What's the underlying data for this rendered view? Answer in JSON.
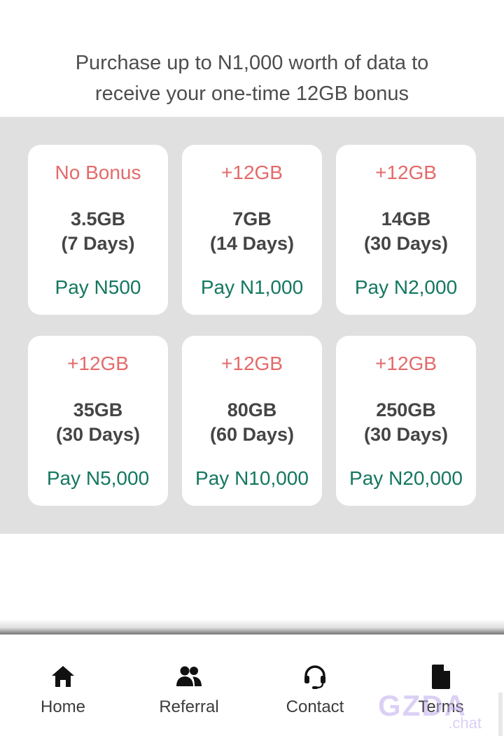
{
  "header": {
    "line1": "Purchase up to N1,000 worth of data to",
    "line2": "receive your one-time 12GB bonus"
  },
  "plans": [
    {
      "bonus": "No Bonus",
      "size": "3.5GB",
      "duration": "(7 Days)",
      "price": "Pay N500"
    },
    {
      "bonus": "+12GB",
      "size": "7GB",
      "duration": "(14 Days)",
      "price": "Pay N1,000"
    },
    {
      "bonus": "+12GB",
      "size": "14GB",
      "duration": "(30 Days)",
      "price": "Pay N2,000"
    },
    {
      "bonus": "+12GB",
      "size": "35GB",
      "duration": "(30 Days)",
      "price": "Pay N5,000"
    },
    {
      "bonus": "+12GB",
      "size": "80GB",
      "duration": "(60 Days)",
      "price": "Pay N10,000"
    },
    {
      "bonus": "+12GB",
      "size": "250GB",
      "duration": "(30 Days)",
      "price": "Pay N20,000"
    }
  ],
  "nav": {
    "items": [
      {
        "label": "Home",
        "icon": "home-icon"
      },
      {
        "label": "Referral",
        "icon": "users-icon"
      },
      {
        "label": "Contact",
        "icon": "headset-icon"
      },
      {
        "label": "Terms",
        "icon": "document-icon"
      }
    ]
  },
  "watermark": {
    "text": "GZDA",
    "sub": ".chat"
  },
  "colors": {
    "bonus": "#e46a6a",
    "price": "#14775f",
    "band": "#e0e0e0",
    "card": "#ffffff"
  }
}
